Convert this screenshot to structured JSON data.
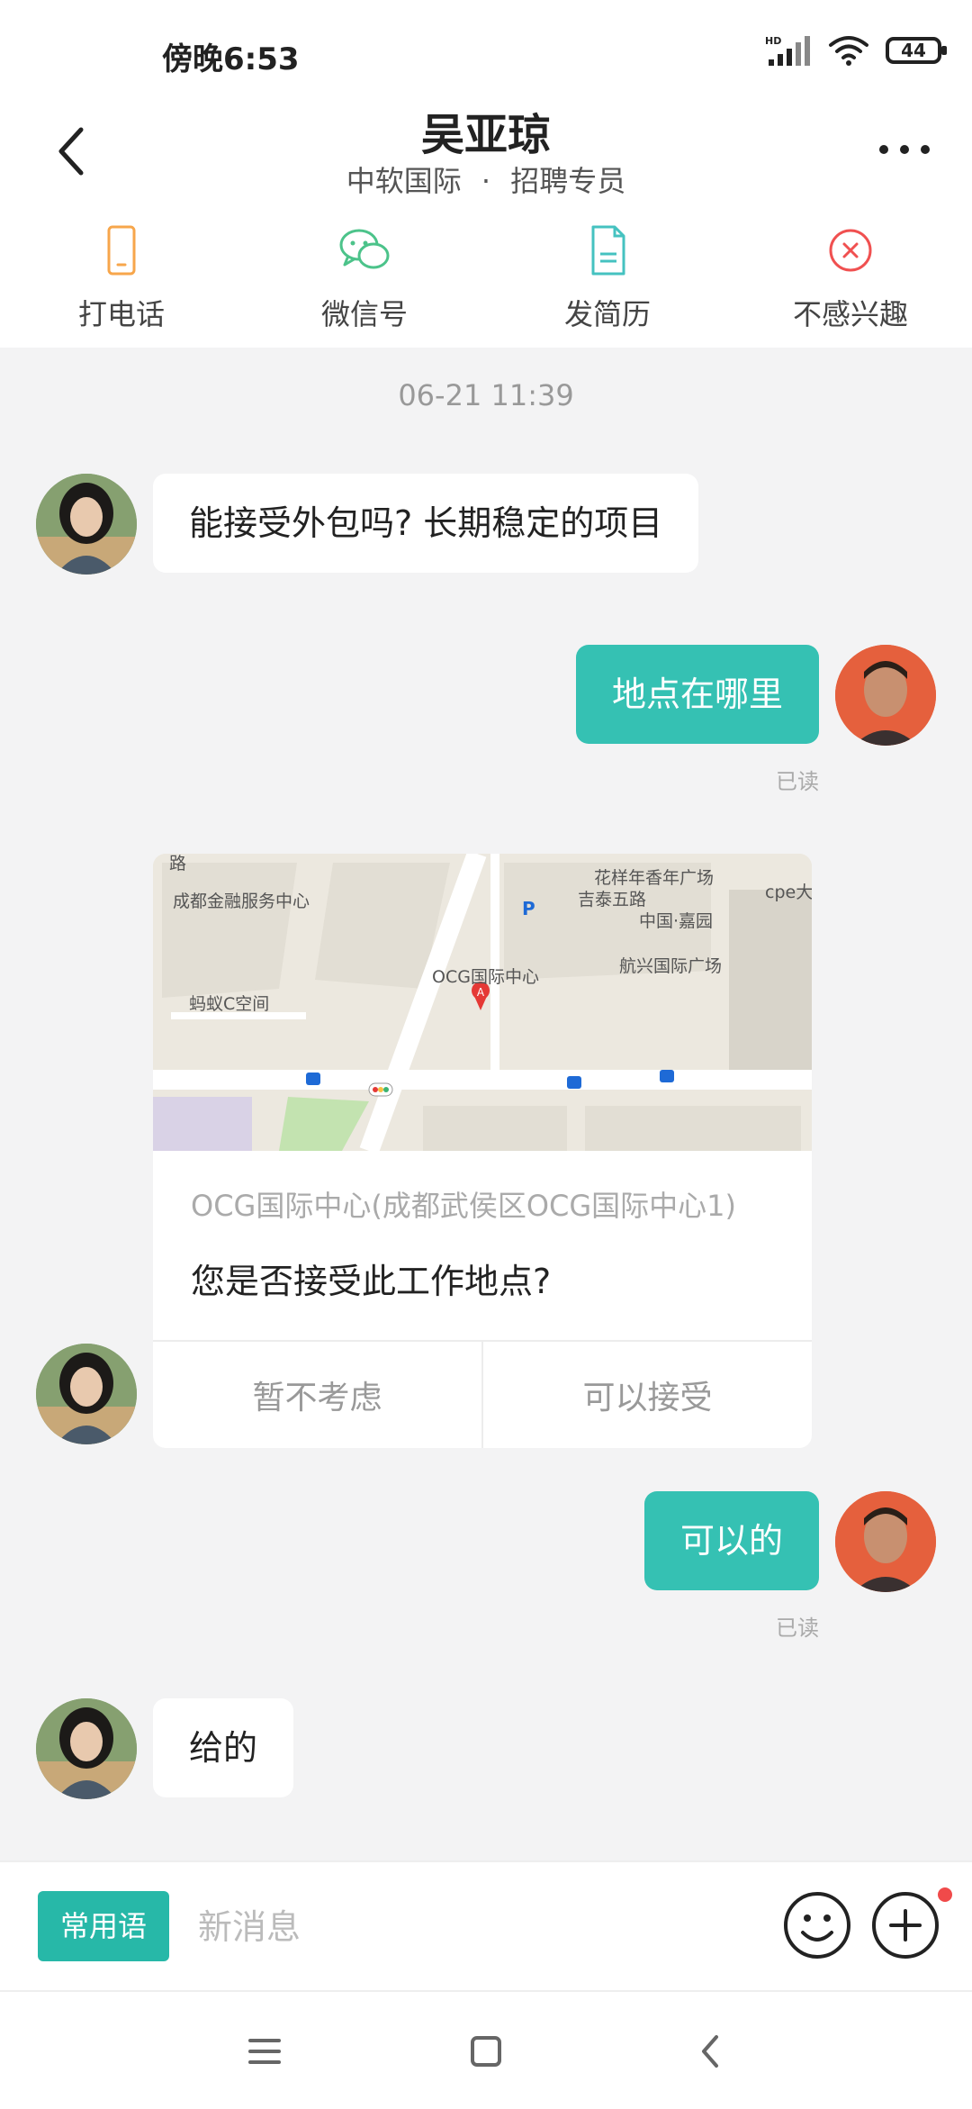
{
  "status_bar": {
    "time": "傍晚6:53",
    "network": "HD",
    "battery": "44"
  },
  "header": {
    "name": "吴亚琼",
    "company": "中软国际",
    "separator": "·",
    "role": "招聘专员"
  },
  "actions": [
    {
      "label": "打电话",
      "icon": "phone-icon",
      "color": "#f7a64b"
    },
    {
      "label": "微信号",
      "icon": "wechat-icon",
      "color": "#4cc38a"
    },
    {
      "label": "发简历",
      "icon": "resume-icon",
      "color": "#45c2c0"
    },
    {
      "label": "不感兴趣",
      "icon": "not-interested-icon",
      "color": "#f05050"
    }
  ],
  "chat": {
    "timestamp": "06-21 11:39",
    "messages": [
      {
        "text": "能接受外包吗? 长期稳定的项目"
      },
      {
        "text": "地点在哪里",
        "status": "已读"
      },
      {
        "map_labels": [
          "路",
          "成都金融服务中心",
          "花样年香年广场",
          "吉泰五路",
          "cpe大",
          "中国·嘉园",
          "OCG国际中心",
          "航兴国际广场",
          "蚂蚁C空间"
        ],
        "address": "OCG国际中心(成都武侯区OCG国际中心1)",
        "question": "您是否接受此工作地点?",
        "reject_label": "暂不考虑",
        "accept_label": "可以接受"
      },
      {
        "text": "可以的",
        "status": "已读"
      },
      {
        "text": "给的"
      }
    ]
  },
  "input_bar": {
    "quick_phrase": "常用语",
    "placeholder": "新消息"
  },
  "colors": {
    "accent": "#35c1b3",
    "quick_phrase_bg": "#27b8a8",
    "badge": "#f04a4a"
  }
}
